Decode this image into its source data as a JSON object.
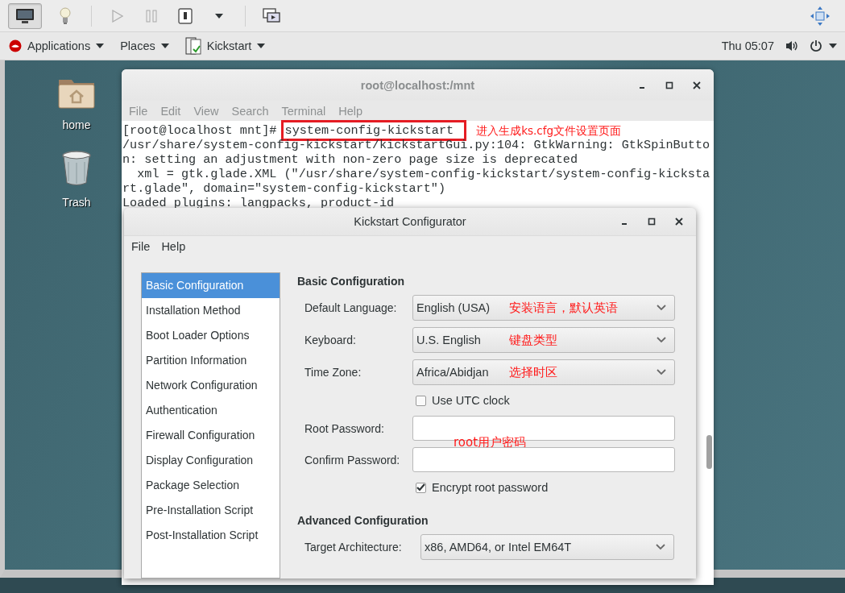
{
  "top_bar": {
    "menus": [
      {
        "label": "Applications",
        "kind": "system"
      },
      {
        "label": "Places",
        "kind": "plain"
      },
      {
        "label": "Kickstart",
        "kind": "app"
      }
    ],
    "clock": "Thu 05:07"
  },
  "desktop_icons": [
    {
      "label": "home",
      "kind": "folder"
    },
    {
      "label": "Trash",
      "kind": "trash"
    }
  ],
  "terminal": {
    "title": "root@localhost:/mnt",
    "menu": [
      "File",
      "Edit",
      "View",
      "Search",
      "Terminal",
      "Help"
    ],
    "prompt": "[root@localhost mnt]# ",
    "command": "system-config-kickstart",
    "annotation": "进入生成ks.cfg文件设置页面",
    "output": [
      "/usr/share/system-config-kickstart/kickstartGui.py:104: GtkWarning: GtkSpinButto",
      "n: setting an adjustment with non-zero page size is deprecated",
      "  xml = gtk.glade.XML (\"/usr/share/system-config-kickstart/system-config-kicksta",
      "rt.glade\", domain=\"system-config-kickstart\")",
      "Loaded plugins: langpacks, product-id"
    ]
  },
  "kickstart": {
    "title": "Kickstart Configurator",
    "menu": [
      "File",
      "Help"
    ],
    "sections": [
      {
        "label": "Basic Configuration",
        "selected": true
      },
      {
        "label": "Installation Method",
        "selected": false
      },
      {
        "label": "Boot Loader Options",
        "selected": false
      },
      {
        "label": "Partition Information",
        "selected": false
      },
      {
        "label": "Network Configuration",
        "selected": false
      },
      {
        "label": "Authentication",
        "selected": false
      },
      {
        "label": "Firewall Configuration",
        "selected": false
      },
      {
        "label": "Display Configuration",
        "selected": false
      },
      {
        "label": "Package Selection",
        "selected": false
      },
      {
        "label": "Pre-Installation Script",
        "selected": false
      },
      {
        "label": "Post-Installation Script",
        "selected": false
      }
    ],
    "basic": {
      "heading": "Basic Configuration",
      "fields": [
        {
          "kind": "dropdown",
          "label": "Default Language:",
          "value": "English (USA)",
          "annotation": "安装语言，默认英语"
        },
        {
          "kind": "dropdown",
          "label": "Keyboard:",
          "value": "U.S. English",
          "annotation": "键盘类型"
        },
        {
          "kind": "dropdown",
          "label": "Time Zone:",
          "value": "Africa/Abidjan",
          "annotation": "选择时区"
        },
        {
          "kind": "checkbox",
          "label": "Use UTC clock",
          "checked": false
        },
        {
          "kind": "password",
          "label": "Root Password:",
          "annotation": "root用户密码"
        },
        {
          "kind": "password",
          "label": "Confirm Password:"
        },
        {
          "kind": "checkbox",
          "label": "Encrypt root password",
          "checked": true
        }
      ]
    },
    "advanced": {
      "heading": "Advanced Configuration",
      "fields": [
        {
          "kind": "dropdown",
          "label": "Target Architecture:",
          "value": "x86, AMD64, or Intel EM64T"
        }
      ]
    }
  }
}
